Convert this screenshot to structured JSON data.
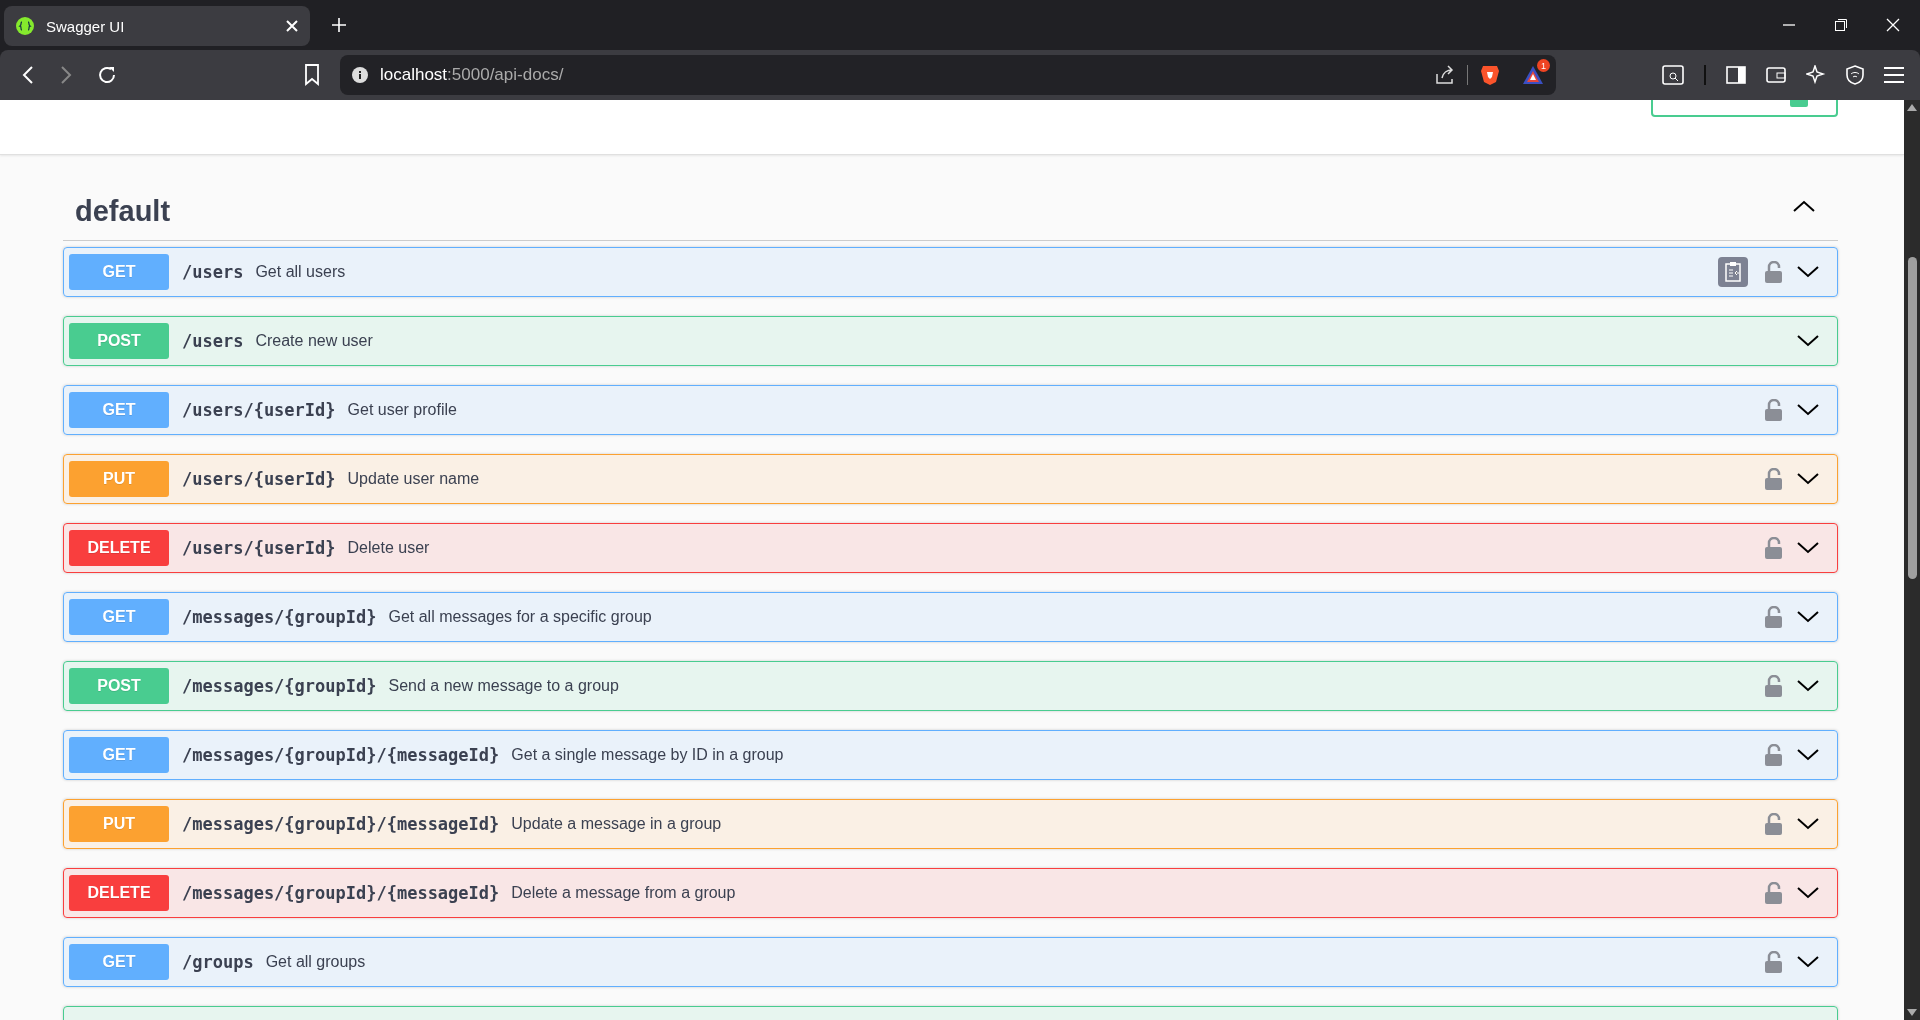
{
  "browser": {
    "tab_title": "Swagger UI",
    "url_host": "localhost",
    "url_rest": ":5000/api-docs/",
    "notification_count": "1"
  },
  "section": {
    "title": "default",
    "expanded": true
  },
  "operations": [
    {
      "kind": "get",
      "method": "GET",
      "path": "/users",
      "summary": "Get all users",
      "copy_button": true,
      "lock": true,
      "expanded": false
    },
    {
      "kind": "post",
      "method": "POST",
      "path": "/users",
      "summary": "Create new user",
      "copy_button": false,
      "lock": false,
      "expanded": false
    },
    {
      "kind": "get",
      "method": "GET",
      "path": "/users/{userId}",
      "summary": "Get user profile",
      "copy_button": false,
      "lock": true,
      "expanded": false
    },
    {
      "kind": "put",
      "method": "PUT",
      "path": "/users/{userId}",
      "summary": "Update user name",
      "copy_button": false,
      "lock": true,
      "expanded": false
    },
    {
      "kind": "delete",
      "method": "DELETE",
      "path": "/users/{userId}",
      "summary": "Delete user",
      "copy_button": false,
      "lock": true,
      "expanded": false
    },
    {
      "kind": "get",
      "method": "GET",
      "path": "/messages/{groupId}",
      "summary": "Get all messages for a specific group",
      "copy_button": false,
      "lock": true,
      "expanded": false
    },
    {
      "kind": "post",
      "method": "POST",
      "path": "/messages/{groupId}",
      "summary": "Send a new message to a group",
      "copy_button": false,
      "lock": true,
      "expanded": false
    },
    {
      "kind": "get",
      "method": "GET",
      "path": "/messages/{groupId}/{messageId}",
      "summary": "Get a single message by ID in a group",
      "copy_button": false,
      "lock": true,
      "expanded": false
    },
    {
      "kind": "put",
      "method": "PUT",
      "path": "/messages/{groupId}/{messageId}",
      "summary": "Update a message in a group",
      "copy_button": false,
      "lock": true,
      "expanded": false
    },
    {
      "kind": "delete",
      "method": "DELETE",
      "path": "/messages/{groupId}/{messageId}",
      "summary": "Delete a message from a group",
      "copy_button": false,
      "lock": true,
      "expanded": false
    },
    {
      "kind": "get",
      "method": "GET",
      "path": "/groups",
      "summary": "Get all groups",
      "copy_button": false,
      "lock": true,
      "expanded": false
    },
    {
      "kind": "post"
    }
  ]
}
